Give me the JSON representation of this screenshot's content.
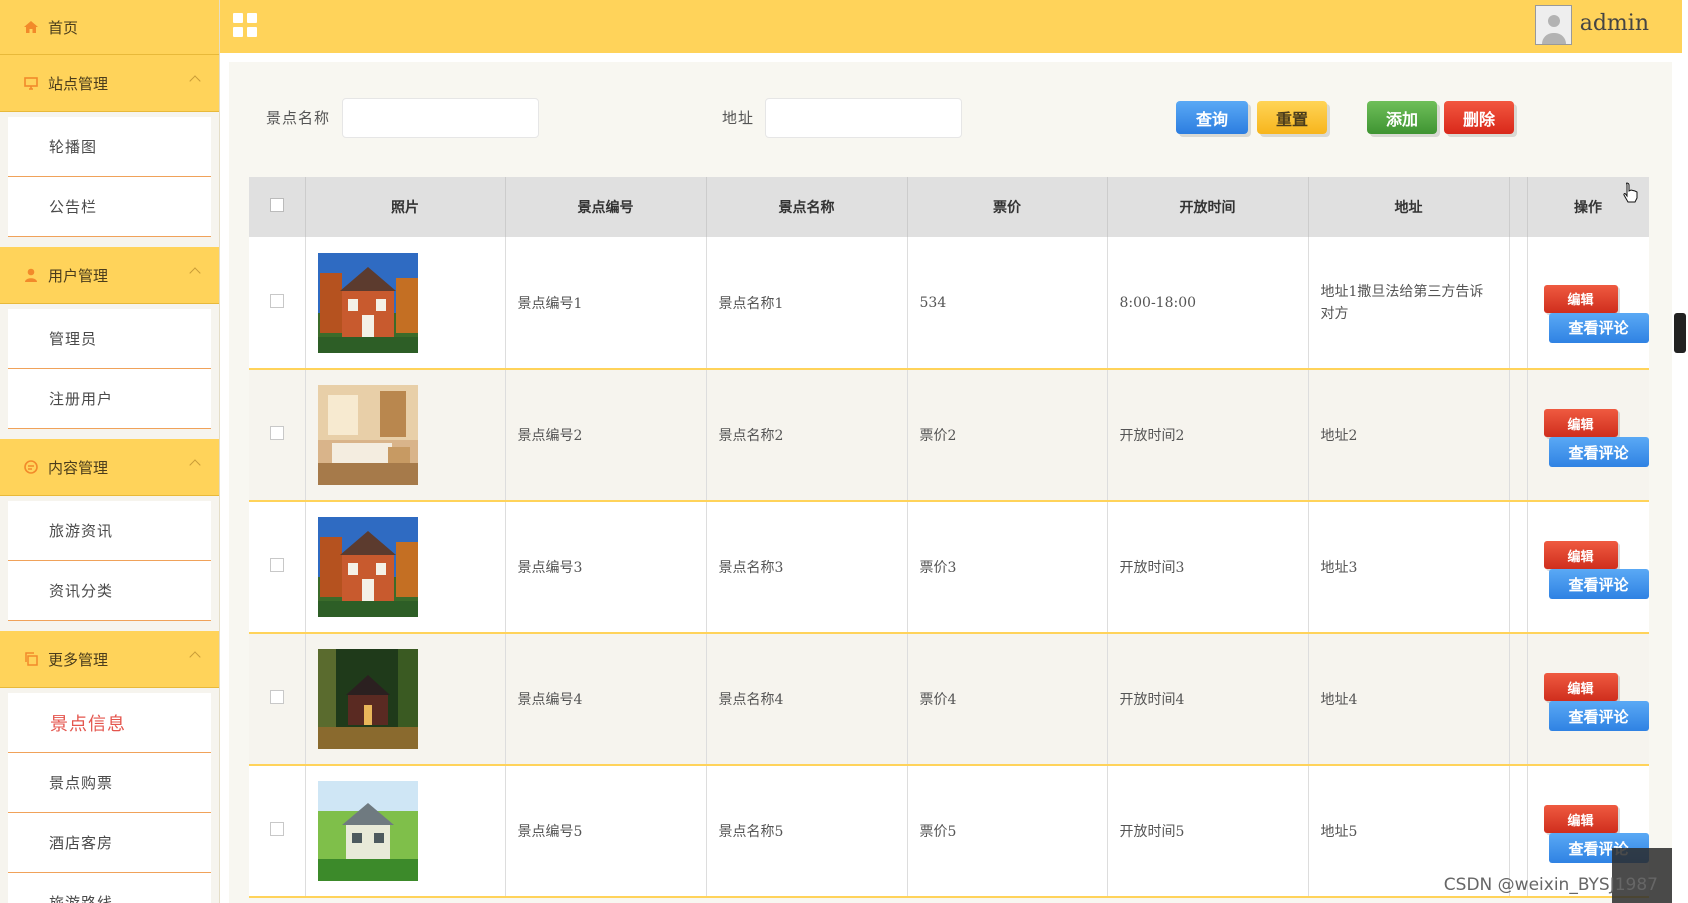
{
  "sidebar": {
    "home": "首页",
    "sections": [
      {
        "title": "站点管理",
        "items": [
          "轮播图",
          "公告栏"
        ]
      },
      {
        "title": "用户管理",
        "items": [
          "管理员",
          "注册用户"
        ]
      },
      {
        "title": "内容管理",
        "items": [
          "旅游资讯",
          "资讯分类"
        ]
      },
      {
        "title": "更多管理",
        "items": [
          "景点信息",
          "景点购票",
          "酒店客房",
          "旅游路线"
        ]
      }
    ]
  },
  "topbar": {
    "username": "admin"
  },
  "search": {
    "name_label": "景点名称",
    "address_label": "地址",
    "query": "查询",
    "reset": "重置",
    "add": "添加",
    "delete": "删除"
  },
  "table": {
    "headers": [
      "照片",
      "景点编号",
      "景点名称",
      "票价",
      "开放时间",
      "地址",
      "操作"
    ],
    "rows": [
      {
        "code": "景点编号1",
        "name": "景点名称1",
        "price": "534",
        "hours": "8:00-18:00",
        "address": "地址1撒旦法给第三方告诉对方",
        "photo": "house-orange"
      },
      {
        "code": "景点编号2",
        "name": "景点名称2",
        "price": "票价2",
        "hours": "开放时间2",
        "address": "地址2",
        "photo": "hotel-room"
      },
      {
        "code": "景点编号3",
        "name": "景点名称3",
        "price": "票价3",
        "hours": "开放时间3",
        "address": "地址3",
        "photo": "house-orange"
      },
      {
        "code": "景点编号4",
        "name": "景点名称4",
        "price": "票价4",
        "hours": "开放时间4",
        "address": "地址4",
        "photo": "cabin-forest"
      },
      {
        "code": "景点编号5",
        "name": "景点名称5",
        "price": "票价5",
        "hours": "开放时间5",
        "address": "地址5",
        "photo": "house-garden"
      }
    ],
    "edit_label": "编辑",
    "view_label": "查看评论"
  },
  "watermark": "CSDN @weixin_BYSJ1987"
}
